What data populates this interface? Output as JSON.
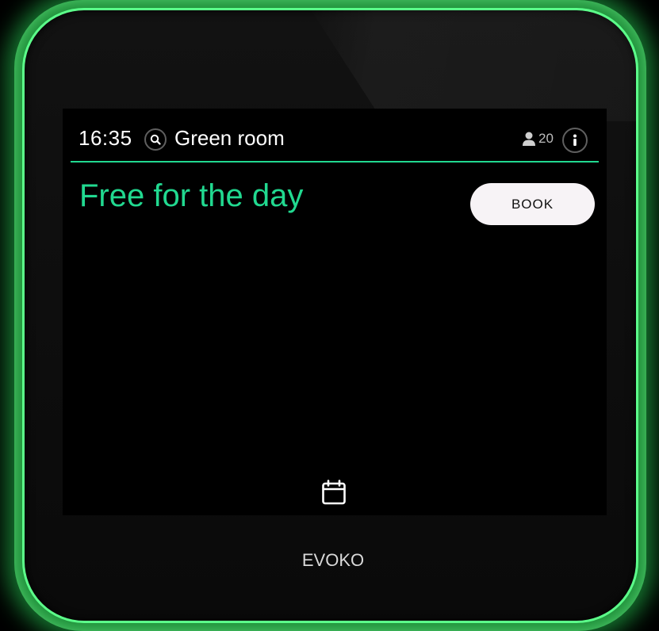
{
  "device": {
    "brand": "EVOKO",
    "frame_color": "#5cff8a",
    "accent_color": "#21d990"
  },
  "header": {
    "time": "16:35",
    "room_name": "Green room",
    "capacity": "20",
    "search_icon": "search-icon",
    "capacity_icon": "person-icon",
    "info_icon": "info-icon"
  },
  "main": {
    "status": "Free for the day",
    "book_label": "BOOK"
  },
  "footer": {
    "calendar_icon": "calendar-icon"
  }
}
